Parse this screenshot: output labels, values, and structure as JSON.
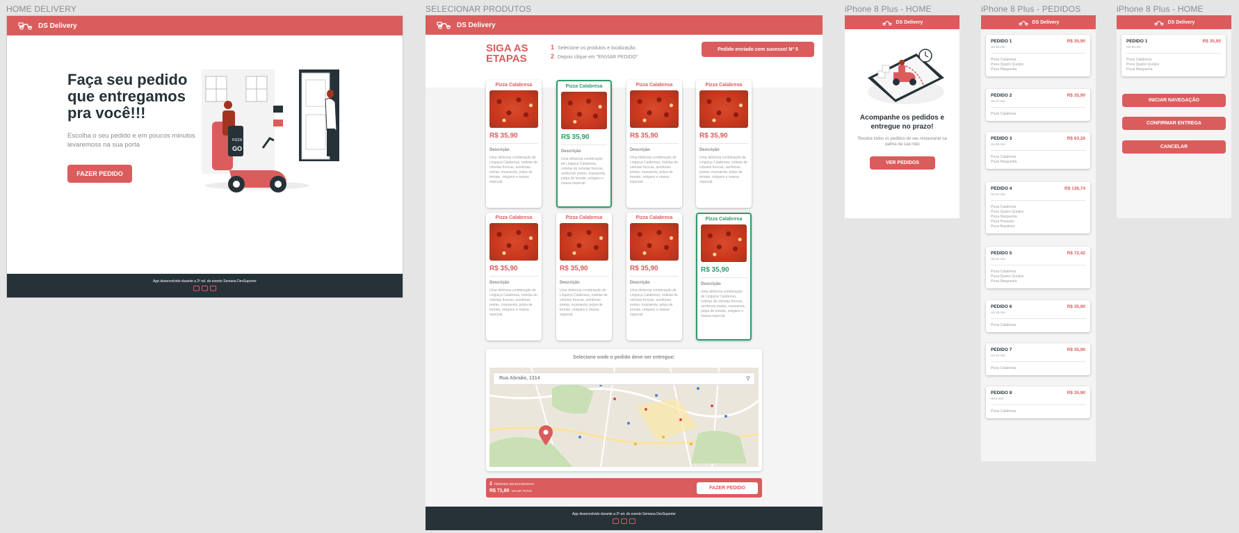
{
  "labels": {
    "f1": "HOME DELIVERY",
    "f2": "SELECIONAR PRODUTOS",
    "f3": "iPhone 8 Plus - HOME",
    "f4": "iPhone 8 Plus - PEDIDOS",
    "f5": "iPhone 8 Plus - HOME"
  },
  "brand": "DS Delivery",
  "colors": {
    "primary": "#da5c5c",
    "dark": "#263238",
    "selected": "#2f9a6a"
  },
  "home": {
    "title": "Faça seu pedido que entregamos pra você!!!",
    "subtitle": "Escolha o seu pedido e em poucos minutos levaremoss na sua porta",
    "button": "FAZER PEDIDO",
    "illustration_sign": "GO"
  },
  "footer": {
    "text": "App desenvolvido durante a 2ª ed. do evento Semana DevSuperior",
    "icons": [
      "youtube-icon",
      "linkedin-icon",
      "instagram-icon"
    ]
  },
  "select": {
    "steps_title": "SIGA AS ETAPAS",
    "step1_num": "1",
    "step1": "Selecione os produtos e localização.",
    "step2_num": "2",
    "step2": "Depois clique em \"ENVIAR PEDIDO\"",
    "success": "Pedido enviado com sucesso! Nº 5",
    "products": [
      {
        "name": "Pizza Calabresa",
        "price": "R$ 35,90",
        "desc_label": "Descrição",
        "desc": "Uma deliciosa combinação de Linguiça Calabresa, rodelas de cebolas frescas, azeitonas pretas, mussarela, polpa de tomate, orégano e massa especial.",
        "selected": false
      },
      {
        "name": "Pizza Calabresa",
        "price": "R$ 35,90",
        "desc_label": "Descrição",
        "desc": "Uma deliciosa combinação de Linguiça Calabresa, rodelas de cebolas frescas, azeitonas pretas, mussarela, polpa de tomate, orégano e massa especial.",
        "selected": true
      },
      {
        "name": "Pizza Calabresa",
        "price": "R$ 35,90",
        "desc_label": "Descrição",
        "desc": "Uma deliciosa combinação de Linguiça Calabresa, rodelas de cebolas frescas, azeitonas pretas, mussarela, polpa de tomate, orégano e massa especial.",
        "selected": false
      },
      {
        "name": "Pizza Calabresa",
        "price": "R$ 35,90",
        "desc_label": "Descrição",
        "desc": "Uma deliciosa combinação de Linguiça Calabresa, rodelas de cebolas frescas, azeitonas pretas, mussarela, polpa de tomate, orégano e massa especial.",
        "selected": false
      },
      {
        "name": "Pizza Calabresa",
        "price": "R$ 35,90",
        "desc_label": "Descrição",
        "desc": "Uma deliciosa combinação de Linguiça Calabresa, rodelas de cebolas frescas, azeitonas pretas, mussarela, polpa de tomate, orégano e massa especial.",
        "selected": false
      },
      {
        "name": "Pizza Calabresa",
        "price": "R$ 35,90",
        "desc_label": "Descrição",
        "desc": "Uma deliciosa combinação de Linguiça Calabresa, rodelas de cebolas frescas, azeitonas pretas, mussarela, polpa de tomate, orégano e massa especial.",
        "selected": false
      },
      {
        "name": "Pizza Calabresa",
        "price": "R$ 35,90",
        "desc_label": "Descrição",
        "desc": "Uma deliciosa combinação de Linguiça Calabresa, rodelas de cebolas frescas, azeitonas pretas, mussarela, polpa de tomate, orégano e massa especial.",
        "selected": false
      },
      {
        "name": "Pizza Calabresa",
        "price": "R$ 35,90",
        "desc_label": "Descrição",
        "desc": "Uma deliciosa combinação de Linguiça Calabresa, rodelas de cebolas frescas, azeitonas pretas, mussarela, polpa de tomate, orégano e massa especial.",
        "selected": true
      }
    ],
    "map_title": "Selecione onde o pedido deve ser entregue:",
    "address": "Rua Abraão, 1314",
    "summary_count": "2",
    "summary_count_label": "PEDIDOS SELECIONADOS",
    "summary_total": "R$ 71,80",
    "summary_total_label": "VALOR TOTAL",
    "order_button": "FAZER PEDIDO"
  },
  "mobile_home": {
    "title": "Acompanhe os pedidos e entregue no prazo!",
    "subtitle": "Receba todos os pedidos do seu restaurante na palma da sua mão",
    "button": "VER PEDIDOS"
  },
  "orders": [
    {
      "name": "PEDIDO 1",
      "price": "R$ 35,90",
      "time": "Há 30 min.",
      "items": [
        "Pizza Calabresa",
        "Pizza Quatro Queijos",
        "Pizza Marguerita"
      ]
    },
    {
      "name": "PEDIDO 2",
      "price": "R$ 35,90",
      "time": "Há 27 min.",
      "items": [
        "Pizza Calabresa"
      ]
    },
    {
      "name": "PEDIDO 3",
      "price": "R$ 63,26",
      "time": "Há 25 min.",
      "items": [
        "Pizza Calabresa",
        "Pizza Marguerita"
      ]
    },
    {
      "name": "PEDIDO 4",
      "price": "R$ 136,74",
      "time": "Há 24 min.",
      "items": [
        "Pizza Calabresa",
        "Pizza Quatro Queijos",
        "Pizza Marguerita",
        "Pizza Presunto",
        "Pizza Brasileira"
      ]
    },
    {
      "name": "PEDIDO 5",
      "price": "R$ 72,42",
      "time": "Há 21 min.",
      "items": [
        "Pizza Calabresa",
        "Pizza Quatro Queijos",
        "Pizza Marguerita"
      ]
    },
    {
      "name": "PEDIDO 6",
      "price": "R$ 35,90",
      "time": "Há 18 min.",
      "items": [
        "Pizza Calabresa"
      ]
    },
    {
      "name": "PEDIDO 7",
      "price": "R$ 35,90",
      "time": "Há 12 min.",
      "items": [
        "Pizza Calabresa"
      ]
    },
    {
      "name": "PEDIDO 8",
      "price": "R$ 35,90",
      "time": "Há 8 min.",
      "items": [
        "Pizza Calabresa"
      ]
    }
  ],
  "detail": {
    "order": {
      "name": "PEDIDO 1",
      "price": "R$ 35,90",
      "time": "Há 30 min.",
      "items": [
        "Pizza Calabresa",
        "Pizza Quatro Queijos",
        "Pizza Marguerita"
      ]
    },
    "btn_nav": "INICIAR NAVEGAÇÃO",
    "btn_confirm": "CONFIRMAR ENTREGA",
    "btn_cancel": "CANCELAR"
  }
}
